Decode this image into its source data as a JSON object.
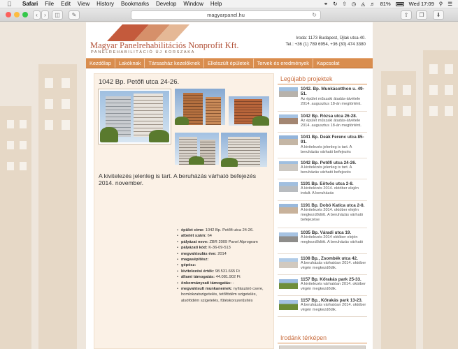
{
  "menubar": {
    "app": "Safari",
    "items": [
      "File",
      "Edit",
      "View",
      "History",
      "Bookmarks",
      "Develop",
      "Window",
      "Help"
    ],
    "battery": "81%",
    "clock": "Wed 17:09"
  },
  "browser": {
    "url": "magyarpanel.hu",
    "colors": {
      "close": "#fc605c",
      "minimize": "#fdbc40",
      "zoom": "#34c84a"
    }
  },
  "site": {
    "logo_title": "Magyar Panelrehabilitációs Nonprofit Kft.",
    "logo_subtitle": "PANELREHABILITÁCIÓ ÚJ KORSZAKA",
    "contact_address": "Iroda: 1173 Budapest, Újlak utca 40.",
    "contact_phone": "Tel.: +36 (1) 789 6954, +36 (30) 474 3380",
    "nav": [
      "Kezdőlap",
      "Lakóknak",
      "Társasház kezelőknek",
      "Elkészült épületek",
      "Tervek és eredmények",
      "Kapcsolat"
    ],
    "accent": "#d98d4e"
  },
  "main": {
    "title": "1042 Bp. Petőfi utca 24-26.",
    "status": "A kivitelezés jelenleg is tart. A beruházás várható befejezés 2014. november.",
    "details": [
      {
        "label": "épület címe:",
        "value": "1042 Bp. Petőfi utca 24-26."
      },
      {
        "label": "albetét szám:",
        "value": "64"
      },
      {
        "label": "pályázat neve:",
        "value": "ZBR 2009 Panel Alprogram"
      },
      {
        "label": "pályázati kód:",
        "value": "K-36-09-513"
      },
      {
        "label": "megvalósulás éve:",
        "value": "2014"
      },
      {
        "label": "magasépítész:",
        "value": ""
      },
      {
        "label": "gépész:",
        "value": ""
      },
      {
        "label": "kivitelezési érték:",
        "value": "98.531.665 Ft"
      },
      {
        "label": "állami támogatás:",
        "value": "44.081.902 Ft"
      },
      {
        "label": "önkormányzati támogatás:",
        "value": "-"
      },
      {
        "label": "megvalósult munkanemek:",
        "value": "nyílászáró csere, homlokzatszigetelés, tetőfödém szigetelés, alsófödém szigetelés, fűtéskorszerűsítés"
      }
    ]
  },
  "sidebar": {
    "heading": "Legújabb projektek",
    "projects": [
      {
        "title": "1042. Bp. Munkásotthon u. 49-51.",
        "text": "Az épület műszaki átadás-átvétele 2014. augusztus 18-án megtörtént."
      },
      {
        "title": "1042 Bp. Rózsa utca 26-28.",
        "text": "Az épület műszaki átadás-átvétele 2014. augusztus 18-án megtörtént."
      },
      {
        "title": "1041 Bp. Deák Ferenc utca 85-91.",
        "text": "A kivitelezés jelenleg is tart. A beruházás várható befejezés"
      },
      {
        "title": "1042 Bp. Petőfi utca 24-26.",
        "text": "A kivitelezés jelenleg is tart. A beruházás várható befejezés"
      },
      {
        "title": "1191 Bp. Eötvös utca 2-8.",
        "text": "A kivitelezés 2014. október elején indult. A beruházás"
      },
      {
        "title": "1191 Bp. Dobó Katica utca 2-8.",
        "text": "A kivitelezés 2014. október elején megkezdődött. A beruházás várható befejezése"
      },
      {
        "title": "1035 Bp. Váradi utca 19.",
        "text": "A kivitelezés 2014 október elején megkezdődött. A beruházás várható"
      },
      {
        "title": "1108 Bp., Zsombék utca 42.",
        "text": "A beruházás várhatóan 2014. október végén megkezdődik."
      },
      {
        "title": "1157 Bp. Kőrakás park 25-33.",
        "text": "A kivitelezés várhatóan 2014. október végén megkezdődik."
      },
      {
        "title": "1157 Bp., Kőrakás park 13-23.",
        "text": "A beruházás várhatóan 2014. október végén megkezdődik."
      }
    ],
    "map_heading": "Irodánk térképen"
  }
}
